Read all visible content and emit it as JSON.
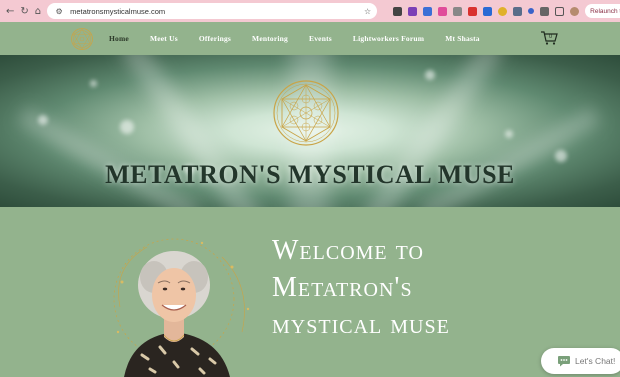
{
  "browser": {
    "url": "metatronsmysticalmuse.com",
    "relaunch_label": "Relaunch to upd",
    "icons": [
      "back-icon",
      "reload-icon",
      "home-icon",
      "site-info-icon",
      "bookmark-star-icon"
    ]
  },
  "header": {
    "nav": [
      {
        "label": "Home",
        "active": true
      },
      {
        "label": "Meet Us"
      },
      {
        "label": "Offerings"
      },
      {
        "label": "Mentoring"
      },
      {
        "label": "Events"
      },
      {
        "label": "Lightworkers Forum"
      },
      {
        "label": "Mt Shasta"
      }
    ],
    "cart_count": "0"
  },
  "banner": {
    "title": "METATRON'S MYSTICAL MUSE"
  },
  "welcome": {
    "line1": "Welcome to",
    "line2": "Metatron's",
    "line3": "mystical muse"
  },
  "chat": {
    "label": "Let's Chat!"
  },
  "colors": {
    "page_green": "#93b38d",
    "chrome_pink": "#f4c9d2",
    "gold": "#c9a447",
    "banner_dark": "#2e4d3b"
  }
}
